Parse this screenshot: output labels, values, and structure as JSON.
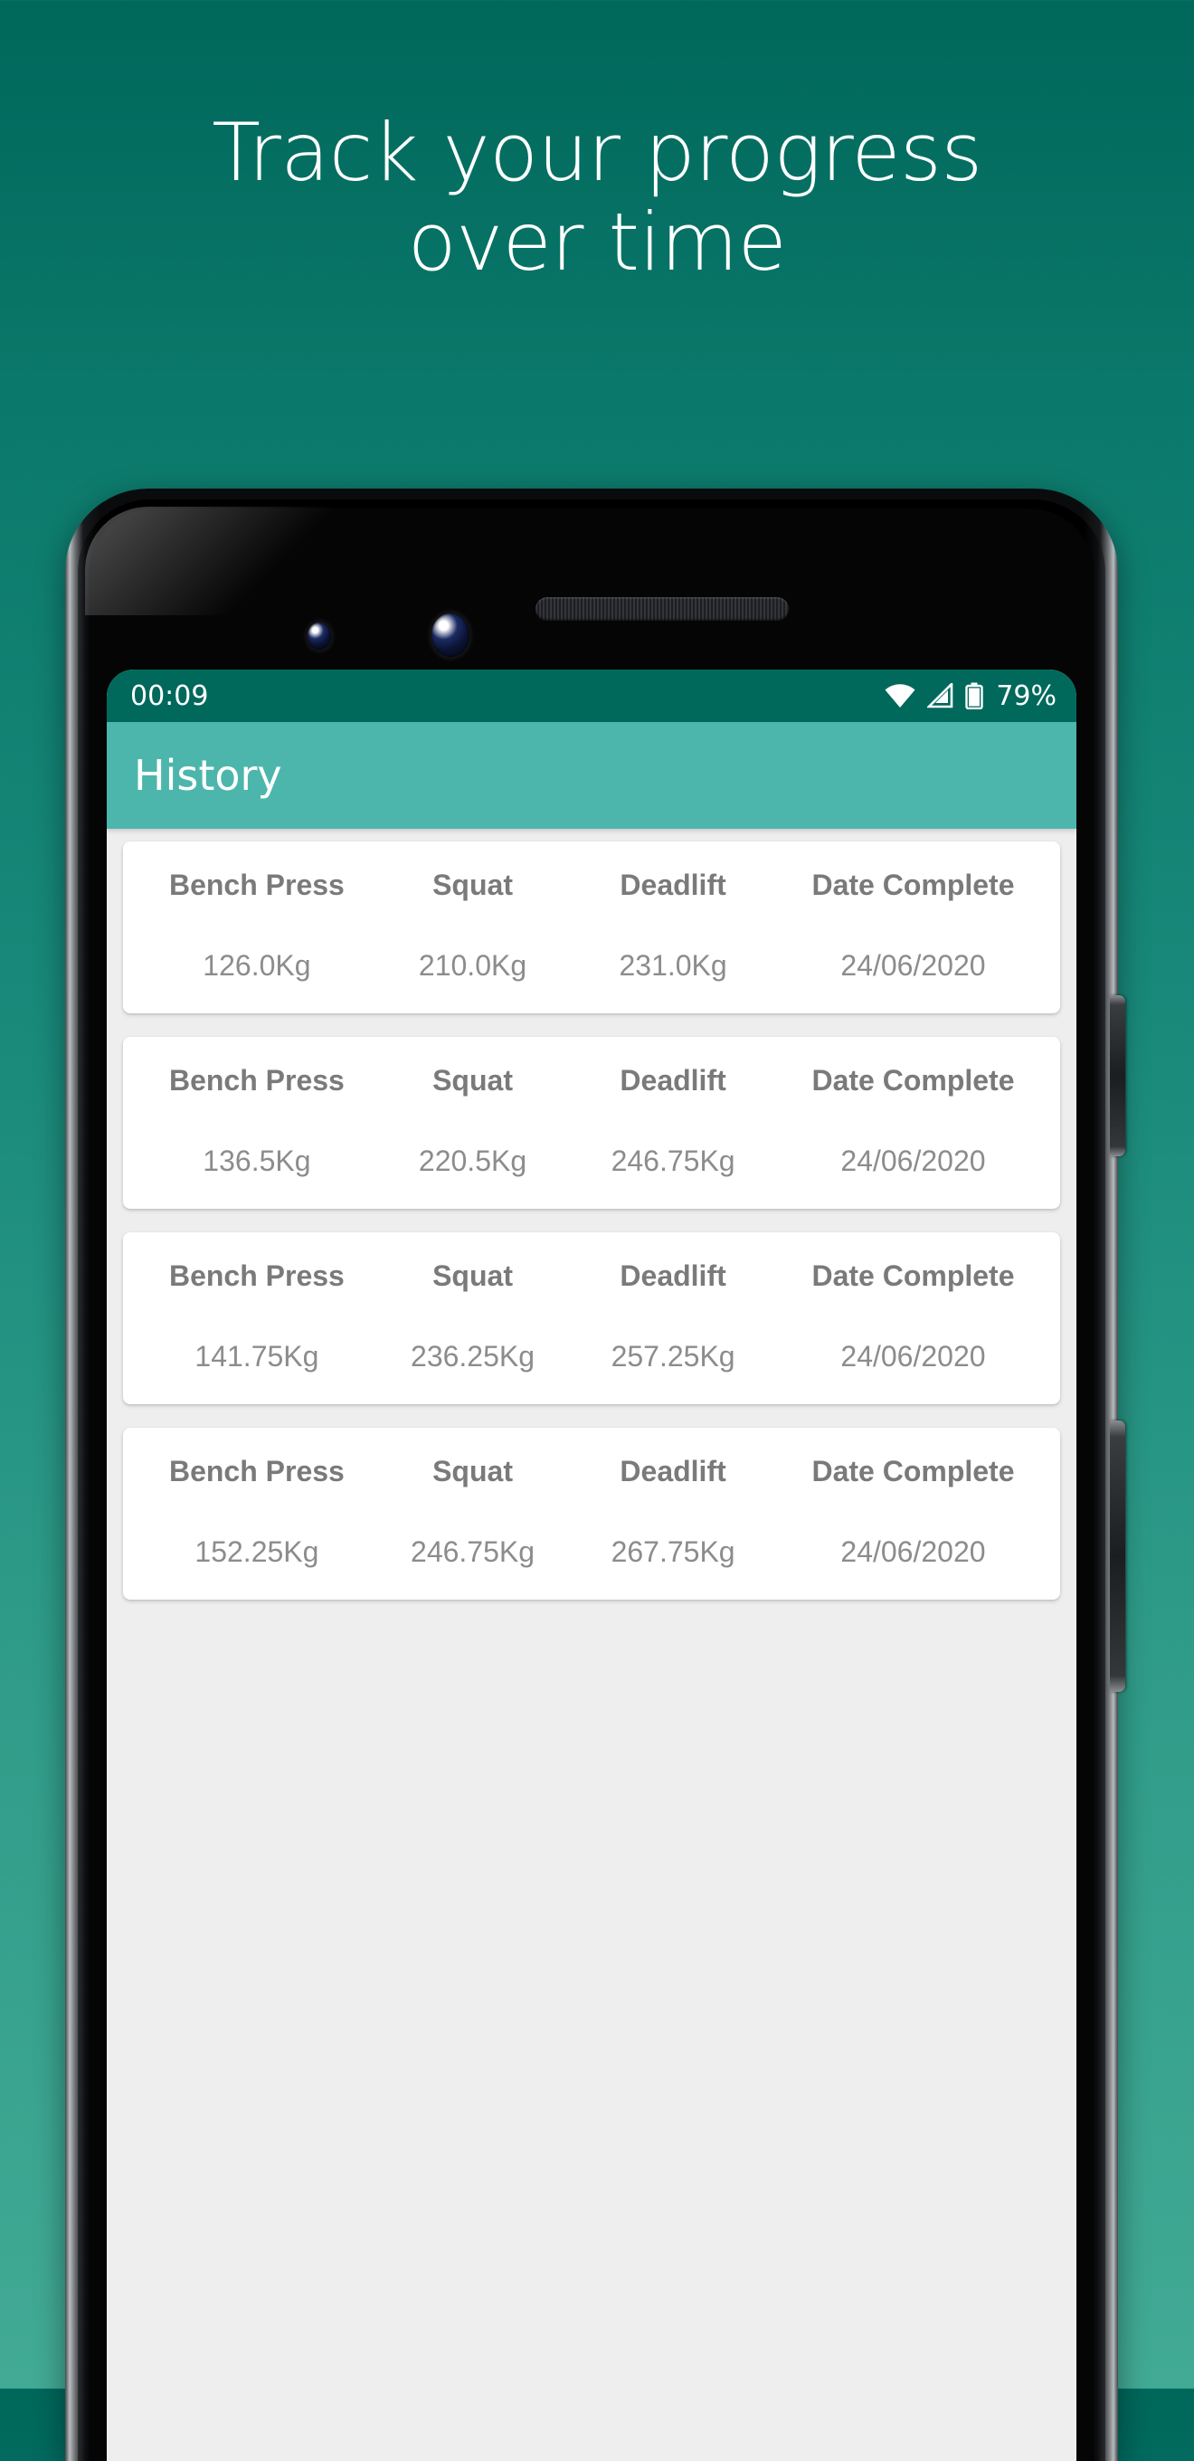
{
  "promo": {
    "headline_line1": "Track your progress",
    "headline_line2": "over time",
    "bg_gradient_top": "#00675b",
    "bg_gradient_bottom": "#42aa95"
  },
  "status_bar": {
    "time": "00:09",
    "battery_percent": "79%",
    "icons": [
      "wifi-icon",
      "cellular-signal-icon",
      "battery-icon"
    ],
    "background": "#00695c"
  },
  "app_bar": {
    "title": "History",
    "background": "#4db6ac"
  },
  "history": {
    "columns": [
      "Bench Press",
      "Squat",
      "Deadlift",
      "Date Complete"
    ],
    "rows": [
      {
        "bench_press": "126.0Kg",
        "squat": "210.0Kg",
        "deadlift": "231.0Kg",
        "date_complete": "24/06/2020"
      },
      {
        "bench_press": "136.5Kg",
        "squat": "220.5Kg",
        "deadlift": "246.75Kg",
        "date_complete": "24/06/2020"
      },
      {
        "bench_press": "141.75Kg",
        "squat": "236.25Kg",
        "deadlift": "257.25Kg",
        "date_complete": "24/06/2020"
      },
      {
        "bench_press": "152.25Kg",
        "squat": "246.75Kg",
        "deadlift": "267.75Kg",
        "date_complete": "24/06/2020"
      }
    ]
  },
  "device": {
    "body_color": "#0a0b0c",
    "screen_background": "#eeeeee"
  }
}
